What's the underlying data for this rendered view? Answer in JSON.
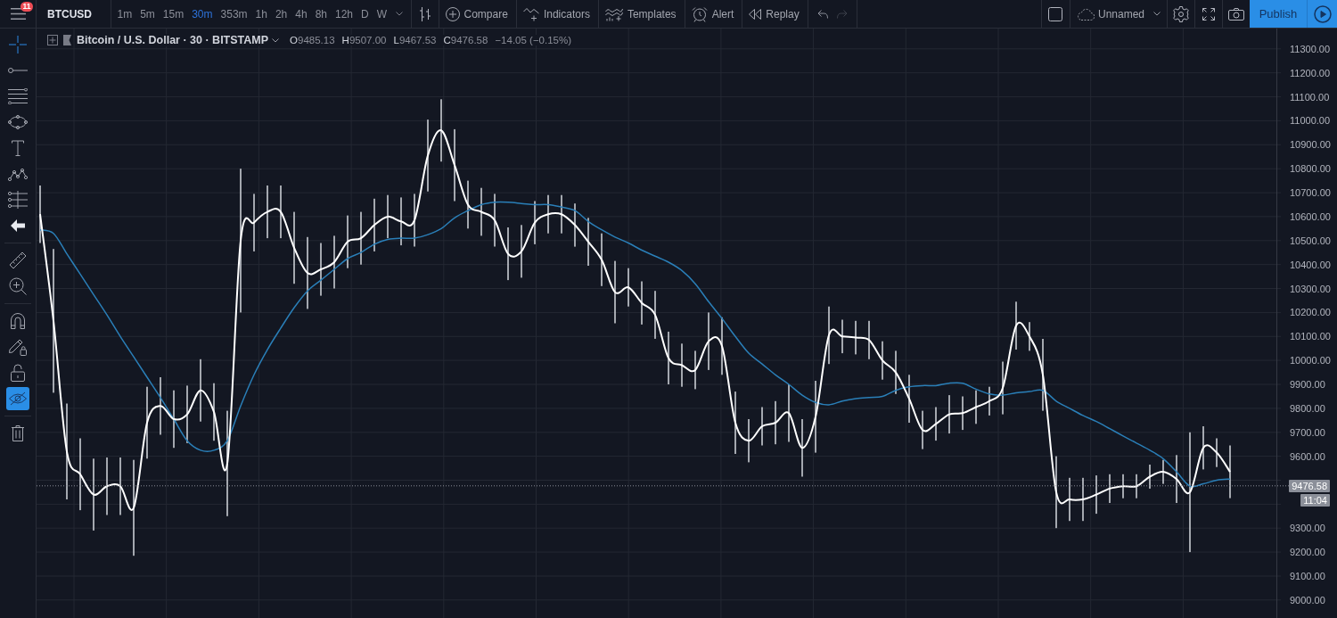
{
  "header": {
    "notification_count": "11",
    "symbol": "BTCUSD",
    "intervals": [
      {
        "label": "1m",
        "selected": false
      },
      {
        "label": "5m",
        "selected": false
      },
      {
        "label": "15m",
        "selected": false
      },
      {
        "label": "30m",
        "selected": true
      },
      {
        "label": "353m",
        "selected": false
      },
      {
        "label": "1h",
        "selected": false
      },
      {
        "label": "2h",
        "selected": false
      },
      {
        "label": "4h",
        "selected": false
      },
      {
        "label": "8h",
        "selected": false
      },
      {
        "label": "12h",
        "selected": false
      },
      {
        "label": "D",
        "selected": false
      },
      {
        "label": "W",
        "selected": false
      }
    ],
    "actions": [
      {
        "label": "Compare"
      },
      {
        "label": "Indicators"
      },
      {
        "label": "Templates"
      },
      {
        "label": "Alert"
      },
      {
        "label": "Replay"
      }
    ],
    "history": [
      {
        "disabled": false
      },
      {
        "disabled": true
      }
    ],
    "layout_name": "Unnamed",
    "publish": "Publish"
  },
  "drawing_toolbar": {
    "tool_groups": [
      [
        {
          "selected": true
        },
        {
          "selected": false
        },
        {
          "selected": false
        },
        {
          "selected": false
        },
        {
          "selected": false
        },
        {
          "selected": false
        },
        {
          "selected": false
        },
        {
          "selected": false
        }
      ],
      [
        {
          "selected": false
        },
        {
          "selected": false
        }
      ]
    ],
    "toggles": [
      {
        "on": false
      },
      {
        "on": false
      },
      {
        "on": false
      },
      {
        "on": true
      }
    ]
  },
  "chart": {
    "legend": {
      "title": "Bitcoin / U.S. Dollar · 30 · BITSTAMP",
      "ohlc": [
        {
          "key": "O",
          "value": "9485.13"
        },
        {
          "key": "H",
          "value": "9507.00"
        },
        {
          "key": "L",
          "value": "9467.53"
        },
        {
          "key": "C",
          "value": "9476.58"
        }
      ],
      "change": "−14.05 (−0.15%)"
    },
    "chart_data": {
      "type": "line",
      "grid": true,
      "ylim": [
        8925,
        11385
      ],
      "yticks": [
        {
          "value": 9000,
          "label": "9000.00"
        },
        {
          "value": 9100,
          "label": "9100.00"
        },
        {
          "value": 9200,
          "label": "9200.00"
        },
        {
          "value": 9300,
          "label": "9300.00"
        },
        {
          "value": 9600,
          "label": "9600.00"
        },
        {
          "value": 9700,
          "label": "9700.00"
        },
        {
          "value": 9800,
          "label": "9800.00"
        },
        {
          "value": 9900,
          "label": "9900.00"
        },
        {
          "value": 10000,
          "label": "10000.00"
        },
        {
          "value": 10100,
          "label": "10100.00"
        },
        {
          "value": 10200,
          "label": "10200.00"
        },
        {
          "value": 10300,
          "label": "10300.00"
        },
        {
          "value": 10400,
          "label": "10400.00"
        },
        {
          "value": 10500,
          "label": "10500.00"
        },
        {
          "value": 10600,
          "label": "10600.00"
        },
        {
          "value": 10700,
          "label": "10700.00"
        },
        {
          "value": 10800,
          "label": "10800.00"
        },
        {
          "value": 10900,
          "label": "10900.00"
        },
        {
          "value": 11000,
          "label": "11000.00"
        },
        {
          "value": 11100,
          "label": "11100.00"
        },
        {
          "value": 11200,
          "label": "11200.00"
        },
        {
          "value": 11300,
          "label": "11300.00"
        }
      ],
      "series": [
        {
          "color": "#ffffff",
          "values": [
            10610,
            10165,
            9620,
            9525,
            9440,
            9475,
            9475,
            9385,
            9740,
            9810,
            9755,
            9775,
            9875,
            9785,
            9570,
            10500,
            10575,
            10620,
            10620,
            10470,
            10365,
            10380,
            10410,
            10495,
            10510,
            10565,
            10600,
            10580,
            10585,
            10855,
            10960,
            10815,
            10650,
            10620,
            10585,
            10445,
            10455,
            10575,
            10610,
            10610,
            10565,
            10495,
            10420,
            10285,
            10305,
            10240,
            10190,
            10010,
            9980,
            9960,
            10080,
            10060,
            9740,
            9665,
            9725,
            9740,
            9780,
            9635,
            9765,
            10105,
            10100,
            10095,
            10085,
            10000,
            9950,
            9840,
            9710,
            9735,
            9775,
            9780,
            9805,
            9830,
            9885,
            10145,
            10100,
            9940,
            9450,
            9420,
            9420,
            9440,
            9465,
            9475,
            9475,
            9515,
            9535,
            9505,
            9450,
            9635,
            9615,
            9535
          ],
          "errors": [
            120,
            300,
            200,
            150,
            150,
            120,
            120,
            200,
            150,
            120,
            120,
            120,
            130,
            120,
            220,
            300,
            120,
            110,
            110,
            150,
            150,
            110,
            110,
            110,
            110,
            110,
            90,
            100,
            110,
            150,
            130,
            150,
            100,
            100,
            110,
            110,
            110,
            90,
            80,
            80,
            90,
            100,
            110,
            130,
            80,
            90,
            100,
            110,
            90,
            80,
            120,
            120,
            130,
            90,
            80,
            90,
            120,
            120,
            150,
            120,
            70,
            70,
            80,
            80,
            90,
            100,
            80,
            70,
            80,
            70,
            70,
            60,
            110,
            100,
            60,
            150,
            150,
            90,
            90,
            80,
            60,
            50,
            50,
            50,
            50,
            100,
            250,
            90,
            60,
            110
          ]
        },
        {
          "color": "#2a7fb8",
          "values": [
            10545,
            10530,
            10445,
            10360,
            10275,
            10190,
            10100,
            10015,
            9930,
            9845,
            9755,
            9665,
            9625,
            9625,
            9665,
            9810,
            9940,
            10045,
            10135,
            10220,
            10290,
            10335,
            10380,
            10425,
            10450,
            10485,
            10505,
            10510,
            10510,
            10525,
            10550,
            10595,
            10625,
            10650,
            10660,
            10660,
            10655,
            10650,
            10650,
            10640,
            10625,
            10580,
            10545,
            10515,
            10490,
            10460,
            10435,
            10410,
            10375,
            10320,
            10245,
            10175,
            10100,
            10030,
            9985,
            9940,
            9900,
            9855,
            9825,
            9815,
            9830,
            9840,
            9845,
            9850,
            9875,
            9890,
            9895,
            9895,
            9905,
            9905,
            9880,
            9860,
            9855,
            9865,
            9870,
            9875,
            9830,
            9800,
            9770,
            9745,
            9715,
            9685,
            9655,
            9625,
            9590,
            9535,
            9475,
            9485,
            9500,
            9505
          ]
        }
      ],
      "ref_lines": [
        {
          "axis": "y",
          "value": 9476.58
        }
      ]
    },
    "last_price": "9476.58",
    "countdown": "11:04"
  }
}
